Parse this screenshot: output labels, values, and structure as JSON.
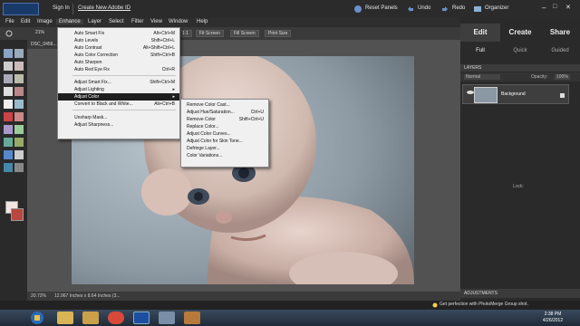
{
  "topbar": {
    "sign_in": "Sign In",
    "create_id": "Create New Adobe ID",
    "reset_panels": "Reset Panels",
    "undo": "Undo",
    "redo": "Redo",
    "organizer": "Organizer"
  },
  "menubar": [
    "File",
    "Edit",
    "Image",
    "Enhance",
    "Layer",
    "Select",
    "Filter",
    "View",
    "Window",
    "Help"
  ],
  "options": {
    "zoom": "21%",
    "buttons": [
      "1:1",
      "Fit Screen",
      "Fill Screen",
      "Print Size"
    ]
  },
  "doc": {
    "tab": "DSC_0456...",
    "zoom": "20.72%",
    "size": "12.967 Inches x 8.64 Inches (3..."
  },
  "panel": {
    "tabs": [
      "Edit",
      "Create",
      "Share"
    ],
    "subtabs": [
      "Full",
      "Quick",
      "Guided"
    ],
    "layers_header": "LAYERS",
    "blend_mode": "Normal",
    "opacity_label": "Opacity:",
    "opacity": "100%",
    "lock_label": "Lock:",
    "layer_name": "Background",
    "adjustments_header": "ADJUSTMENTS"
  },
  "enhance_menu": [
    {
      "label": "Auto Smart Fix",
      "shortcut": "Alt+Ctrl+M"
    },
    {
      "label": "Auto Levels",
      "shortcut": "Shift+Ctrl+L"
    },
    {
      "label": "Auto Contrast",
      "shortcut": "Alt+Shift+Ctrl+L"
    },
    {
      "label": "Auto Color Correction",
      "shortcut": "Shift+Ctrl+B"
    },
    {
      "label": "Auto Sharpen",
      "shortcut": ""
    },
    {
      "label": "Auto Red Eye Fix",
      "shortcut": "Ctrl+R"
    },
    {
      "label": "Adjust Smart Fix...",
      "shortcut": "Shift+Ctrl+M"
    },
    {
      "label": "Adjust Lighting",
      "shortcut": ""
    },
    {
      "label": "Adjust Color",
      "shortcut": ""
    },
    {
      "label": "Convert to Black and White...",
      "shortcut": "Alt+Ctrl+B"
    },
    {
      "label": "Unsharp Mask...",
      "shortcut": ""
    },
    {
      "label": "Adjust Sharpness...",
      "shortcut": ""
    }
  ],
  "color_submenu": [
    {
      "label": "Remove Color Cast...",
      "shortcut": ""
    },
    {
      "label": "Adjust Hue/Saturation...",
      "shortcut": "Ctrl+U"
    },
    {
      "label": "Remove Color",
      "shortcut": "Shift+Ctrl+U"
    },
    {
      "label": "Replace Color...",
      "shortcut": ""
    },
    {
      "label": "Adjust Color Curves...",
      "shortcut": ""
    },
    {
      "label": "Adjust Color for Skin Tone...",
      "shortcut": ""
    },
    {
      "label": "Defringe Layer...",
      "shortcut": ""
    },
    {
      "label": "Color Variations...",
      "shortcut": ""
    }
  ],
  "tip": "Get perfection with PhotoMerge Group shot.",
  "clock": {
    "time": "2:38 PM",
    "date": "4/26/2012"
  },
  "colors": {
    "accent": "#2b5fa8",
    "menu_bg": "#f0f0f0",
    "highlight": "#1f1f1f"
  }
}
